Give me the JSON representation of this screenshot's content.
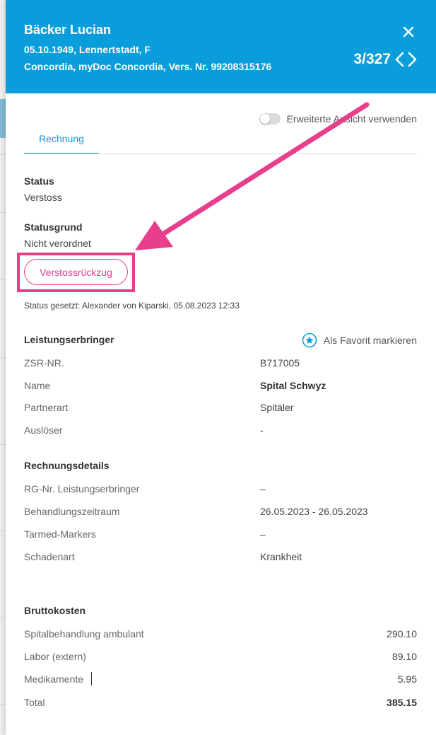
{
  "header": {
    "patient_name": "Bäcker Lucian",
    "patient_info": "05.10.1949, Lennertstadt, F",
    "insurance_info": "Concordia, myDoc Concordia, Vers. Nr. 99208315176",
    "counter": "3/327"
  },
  "view_toggle": {
    "label": "Erweiterte Ansicht verwenden",
    "enabled": false
  },
  "tabs": [
    {
      "label": "Rechnung",
      "active": true
    }
  ],
  "status": {
    "label": "Status",
    "value": "Verstoss",
    "reason_label": "Statusgrund",
    "reason_value": "Nicht verordnet",
    "action_button": "Verstossrückzug",
    "set_by": "Status gesetzt: Alexander von Kiparski, 05.08.2023 12:33"
  },
  "provider": {
    "title": "Leistungserbringer",
    "favorite_label": "Als Favorit markieren",
    "rows": [
      {
        "key": "ZSR-NR.",
        "value": "B717005"
      },
      {
        "key": "Name",
        "value": "Spital Schwyz"
      },
      {
        "key": "Partnerart",
        "value": "Spitäler"
      },
      {
        "key": "Auslöser",
        "value": "-"
      }
    ]
  },
  "invoice_details": {
    "title": "Rechnungsdetails",
    "rows": [
      {
        "key": "RG-Nr. Leistungserbringer",
        "value": "–"
      },
      {
        "key": "Behandlungszeitraum",
        "value": "26.05.2023 - 26.05.2023"
      },
      {
        "key": "Tarmed-Markers",
        "value": "–"
      },
      {
        "key": "Schadenart",
        "value": "Krankheit"
      }
    ]
  },
  "gross_costs": {
    "title": "Bruttokosten",
    "rows": [
      {
        "key": "Spitalbehandlung ambulant",
        "value": "290.10"
      },
      {
        "key": "Labor (extern)",
        "value": "89.10"
      },
      {
        "key": "Medikamente",
        "value": "5.95"
      },
      {
        "key": "Total",
        "value": "385.15"
      }
    ]
  },
  "colors": {
    "primary": "#0a9ddb",
    "highlight": "#e83e8c"
  }
}
